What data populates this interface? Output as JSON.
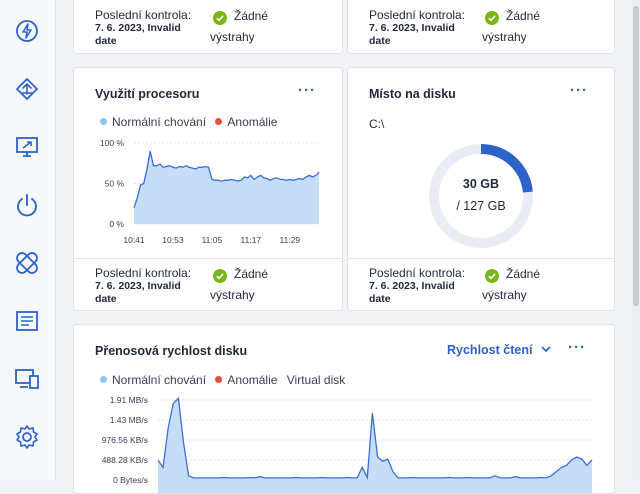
{
  "sidebar": {
    "items": [
      {
        "icon": "lightning-icon"
      },
      {
        "icon": "network-icon"
      },
      {
        "icon": "remote-desktop-icon"
      },
      {
        "icon": "power-icon"
      },
      {
        "icon": "patch-icon"
      },
      {
        "icon": "report-icon"
      },
      {
        "icon": "devices-icon"
      },
      {
        "icon": "gear-icon"
      }
    ]
  },
  "top_cards": [
    {
      "last_check_label": "Poslední kontrola:",
      "last_check_date": "7. 6. 2023, Invalid date",
      "status": "Žádné výstrahy"
    },
    {
      "last_check_label": "Poslední kontrola:",
      "last_check_date": "7. 6. 2023, Invalid date",
      "status": "Žádné výstrahy"
    }
  ],
  "cpu_card": {
    "title": "Využití procesoru",
    "menu": "···",
    "legend": {
      "normal": "Normální chování",
      "anomaly": "Anomálie"
    },
    "last_check_label": "Poslední kontrola:",
    "last_check_date": "7. 6. 2023, Invalid date",
    "status": "Žádné výstrahy"
  },
  "disk_card": {
    "title": "Místo na disku",
    "menu": "···",
    "drive": "C:\\",
    "used": "30 GB",
    "total": "/ 127 GB",
    "used_fraction": 0.236,
    "last_check_label": "Poslední kontrola:",
    "last_check_date": "7. 6. 2023, Invalid date",
    "status": "Žádné výstrahy"
  },
  "transfer_card": {
    "title": "Přenosová rychlost disku",
    "dropdown": "Rychlost čtení",
    "menu": "···",
    "legend": {
      "normal": "Normální chování",
      "anomaly": "Anomálie",
      "series": "Virtual disk"
    }
  },
  "colors": {
    "accent": "#2d62c8",
    "normal": "#8ec5f2",
    "anomaly": "#e0513f",
    "ok": "#7cb518",
    "line": "#3a6fd8",
    "fill": "#c5ddf6"
  },
  "chart_data": [
    {
      "type": "area",
      "title": "Využití procesoru",
      "y_ticks": [
        "100 %",
        "50 %",
        "0 %"
      ],
      "ylim": [
        0,
        100
      ],
      "x_ticks": [
        "10:41",
        "10:53",
        "11:05",
        "11:17",
        "11:29"
      ],
      "xlim": [
        0,
        57
      ],
      "tick_positions": [
        0,
        12,
        24,
        36,
        48
      ],
      "values": [
        20,
        32,
        48,
        50,
        68,
        90,
        72,
        72,
        74,
        70,
        71,
        72,
        70,
        69,
        71,
        70,
        72,
        70,
        69,
        68,
        70,
        70,
        71,
        70,
        55,
        54,
        54,
        53,
        54,
        54,
        55,
        54,
        53,
        54,
        58,
        57,
        60,
        55,
        58,
        60,
        57,
        56,
        54,
        56,
        57,
        55,
        55,
        54,
        55,
        54,
        55,
        56,
        55,
        58,
        60,
        58,
        60,
        64
      ]
    },
    {
      "type": "area",
      "title": "Přenosová rychlost disku",
      "series_name": "Virtual disk",
      "y_ticks": [
        "1.91 MB/s",
        "1.43 MB/s",
        "976.56 KB/s",
        "488.28 KB/s",
        "0 Bytes/s"
      ],
      "ylim": [
        0,
        1.91
      ],
      "values": [
        0.47,
        0.3,
        1.25,
        1.83,
        1.95,
        0.9,
        0.1,
        0.05,
        0.05,
        0.05,
        0.05,
        0.05,
        0.05,
        0.06,
        0.05,
        0.05,
        0.05,
        0.05,
        0.06,
        0.05,
        0.08,
        0.05,
        0.05,
        0.05,
        0.05,
        0.05,
        0.05,
        0.06,
        0.05,
        0.05,
        0.05,
        0.05,
        0.06,
        0.05,
        0.05,
        0.05,
        0.05,
        0.06,
        0.05,
        0.05,
        0.3,
        0.06,
        1.6,
        0.55,
        0.45,
        0.5,
        0.2,
        0.05,
        0.05,
        0.05,
        0.06,
        0.05,
        0.05,
        0.05,
        0.05,
        0.05,
        0.05,
        0.06,
        0.05,
        0.05,
        0.05,
        0.06,
        0.05,
        0.05,
        0.05,
        0.05,
        0.1,
        0.05,
        0.05,
        0.05,
        0.08,
        0.05,
        0.05,
        0.05,
        0.05,
        0.06,
        0.05,
        0.1,
        0.2,
        0.3,
        0.35,
        0.48,
        0.55,
        0.5,
        0.35,
        0.48
      ]
    }
  ]
}
